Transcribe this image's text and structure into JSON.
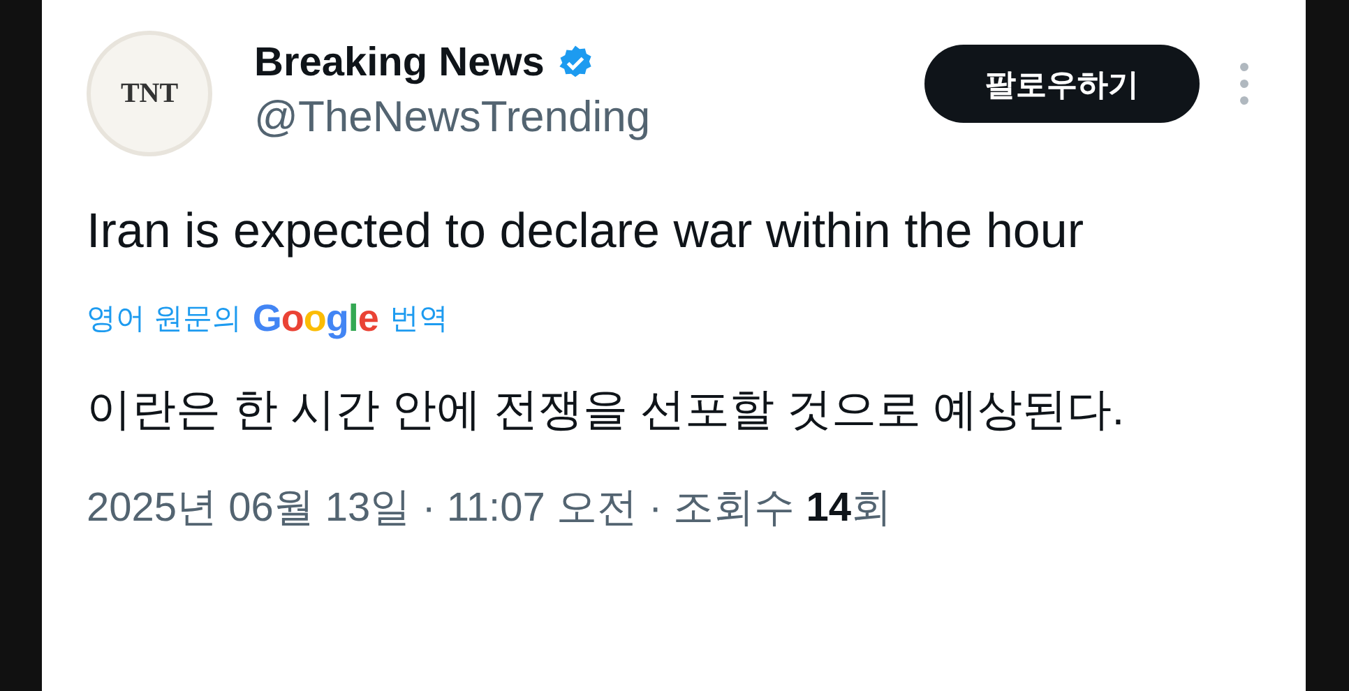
{
  "author": {
    "avatar_text": "TNT",
    "name": "Breaking News",
    "verified": true,
    "handle": "@TheNewsTrending"
  },
  "follow_button": "팔로우하기",
  "tweet_text": "Iran is expected to declare war within the hour",
  "translation": {
    "prefix": "영어 원문의",
    "logo": "Google",
    "suffix": "번역",
    "text": "이란은 한 시간 안에 전쟁을 선포할 것으로 예상된다."
  },
  "meta": "2025년 06월 13일 · 11:07 오전 · 조회수 **14**회"
}
